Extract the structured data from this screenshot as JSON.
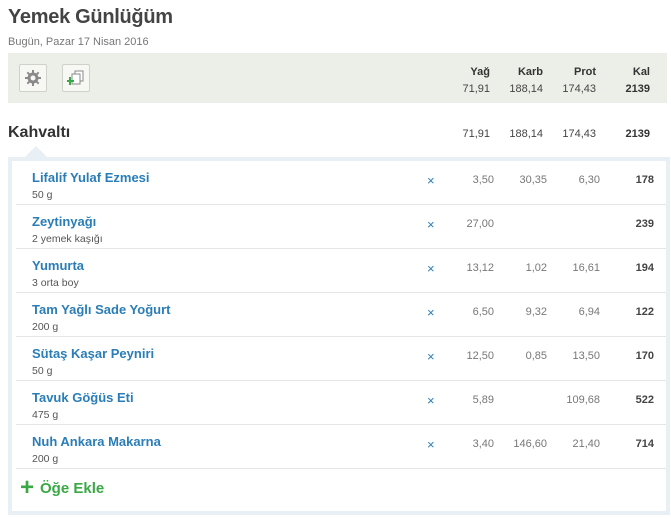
{
  "header": {
    "title": "Yemek Günlüğüm",
    "date": "Bugün, Pazar 17 Nisan 2016"
  },
  "toolbar": {
    "settings_icon": "gear-icon",
    "add_icon": "add-copy-icon",
    "columns": [
      {
        "label": "Yağ",
        "value": "71,91"
      },
      {
        "label": "Karb",
        "value": "188,14"
      },
      {
        "label": "Prot",
        "value": "174,43"
      },
      {
        "label": "Kal",
        "value": "2139"
      }
    ]
  },
  "meal": {
    "title": "Kahvaltı",
    "totals": [
      "71,91",
      "188,14",
      "174,43",
      "2139"
    ],
    "items": [
      {
        "name": "Lifalif Yulaf Ezmesi",
        "amount": "50 g",
        "fat": "3,50",
        "carb": "30,35",
        "prot": "6,30",
        "kal": "178"
      },
      {
        "name": "Zeytinyağı",
        "amount": "2 yemek kaşığı",
        "fat": "27,00",
        "carb": "",
        "prot": "",
        "kal": "239"
      },
      {
        "name": "Yumurta",
        "amount": "3 orta boy",
        "fat": "13,12",
        "carb": "1,02",
        "prot": "16,61",
        "kal": "194"
      },
      {
        "name": "Tam Yağlı Sade Yoğurt",
        "amount": "200 g",
        "fat": "6,50",
        "carb": "9,32",
        "prot": "6,94",
        "kal": "122"
      },
      {
        "name": "Sütaş Kaşar Peyniri",
        "amount": "50 g",
        "fat": "12,50",
        "carb": "0,85",
        "prot": "13,50",
        "kal": "170"
      },
      {
        "name": "Tavuk Göğüs Eti",
        "amount": "475 g",
        "fat": "5,89",
        "carb": "",
        "prot": "109,68",
        "kal": "522"
      },
      {
        "name": "Nuh Ankara Makarna",
        "amount": "200 g",
        "fat": "3,40",
        "carb": "146,60",
        "prot": "21,40",
        "kal": "714"
      }
    ],
    "delete_glyph": "×",
    "add_label": "Öğe Ekle",
    "add_glyph": "+"
  },
  "colors": {
    "link": "#2a7db7",
    "add": "#39a845",
    "toolbar_bg": "#ecefe7",
    "box_border": "#e8eff5"
  }
}
